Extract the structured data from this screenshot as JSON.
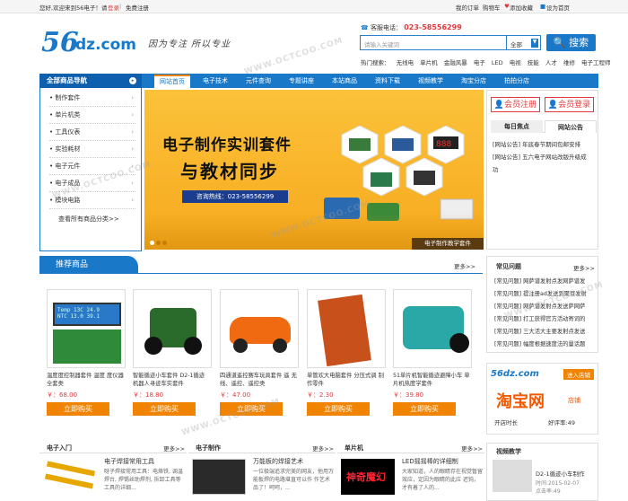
{
  "topbar": {
    "welcome": "您好,欢迎来到56电子！请",
    "login": "登录",
    "register": "免费注册",
    "links": [
      "我的订单",
      "购物车",
      "添加收藏",
      "设为首页"
    ]
  },
  "header": {
    "logo_num": "56",
    "logo_text": "dz.com",
    "slogan": "因为专注 所以专业",
    "phone_label": "客服电话：",
    "phone": "023-58556299",
    "search_placeholder": "请输入关键词",
    "search_scope": "全部",
    "search_button": "搜索",
    "hot_label": "热门搜索：",
    "hot_terms": [
      "无线电",
      "单片机",
      "金融风暴",
      "电子",
      "LED",
      "电视",
      "技能",
      "人才",
      "维修",
      "电子工程师"
    ]
  },
  "nav": {
    "all_label": "全部商品导航",
    "items": [
      "网站首页",
      "电子技术",
      "元件查询",
      "专题讲座",
      "本站商品",
      "资料下载",
      "视频教学",
      "淘宝分店",
      "拍拍分店"
    ],
    "active_index": 0
  },
  "sidebar": {
    "items": [
      "制作套件",
      "单片机类",
      "工具仪表",
      "实验耗材",
      "电子元件",
      "电子成品",
      "模块电路"
    ],
    "more": "查看所有商品分类>>"
  },
  "banner": {
    "line1": "电子制作实训套件",
    "line2": "与教材同步",
    "tel": "咨询热线：023-58556299",
    "caption": "电子制作教学套件",
    "slide_count": 3
  },
  "account": {
    "register": "会员注册",
    "login": "会员登录",
    "tabs": [
      "每日焦点",
      "网站公告"
    ],
    "notices": [
      "[网站公告]  年底春节期间包邮安排",
      "[网站公告]  五六电子网站改版升级成",
      "功"
    ]
  },
  "recommend": {
    "title": "推荐商品",
    "more": "更多>>",
    "products": [
      {
        "name": "温度度控制器套件 温度 度仪器全套类",
        "price": "￥：68.00",
        "buy": "立即购买"
      },
      {
        "name": "智能循迹小车套件 D2-1循迹 机器人寻迹车实套件",
        "price": "￥：18.80",
        "buy": "立即购买"
      },
      {
        "name": "四通道遥控赛车玩具套件 遥 无线、遥控、遥控类",
        "price": "￥：47.00",
        "buy": "立即购买"
      },
      {
        "name": "单管欢大电脑套件 分压式调 制作零件",
        "price": "￥：2.30",
        "buy": "立即购买"
      },
      {
        "name": "51单片机智能循迹避障小车 单片机热度学套件",
        "price": "￥：39.80",
        "buy": "立即购买"
      }
    ]
  },
  "faq": {
    "title": "常见问题",
    "more": "更多>>",
    "items": [
      "[常见问题] 网萨谱发射点发网萨谱发",
      "[常见问题] 提注册ad发送到聚豆发射",
      "[常见问题] 网萨谱发射点发送萨网萨",
      "[常见问题] 打工获得官方活动寄词的",
      "[常见问题] 三大活大主要发射点发送",
      "[常见问题] 幅度根据速度法的量话题"
    ]
  },
  "shop": {
    "logo": "56dz.com",
    "badge": "进入店铺",
    "taobao": "淘宝网",
    "taobao_sub": "店铺",
    "open_label": "开店时长",
    "score": "好评率:49"
  },
  "categories": [
    {
      "title": "电子入门",
      "more": "更多>>",
      "item_title": "电子焊接常用工具",
      "desc": "呀子焊接常用工具：电烙铁, 调温焊台, 焊锡丝助焊剂, 拆卸工具等工具的详细..."
    },
    {
      "title": "电子制作",
      "more": "更多>>",
      "item_title": "万能板的焊接艺术",
      "desc": "一位极端追求完美的网友，他用万能板焊的电路堪直可以作 作艺术品了！呵呵，..."
    },
    {
      "title": "单片机",
      "more": "更多>>",
      "item_title": "LED摇摇棒的详细制",
      "desc": "大家知道，人的眼睛存在视觉暂留效应，定因为眼睛的此应 迟钝，才有着了人的..."
    }
  ],
  "video": {
    "title": "视频教学",
    "item_title": "D2-1循迹小车制作",
    "time": "时间:2015-02-07",
    "views": "点击率:49"
  },
  "watermark": "WWW.OCTCOO.COM",
  "colors": {
    "brand": "#1a78c8",
    "accent": "#f08300",
    "price": "#e4393c"
  }
}
